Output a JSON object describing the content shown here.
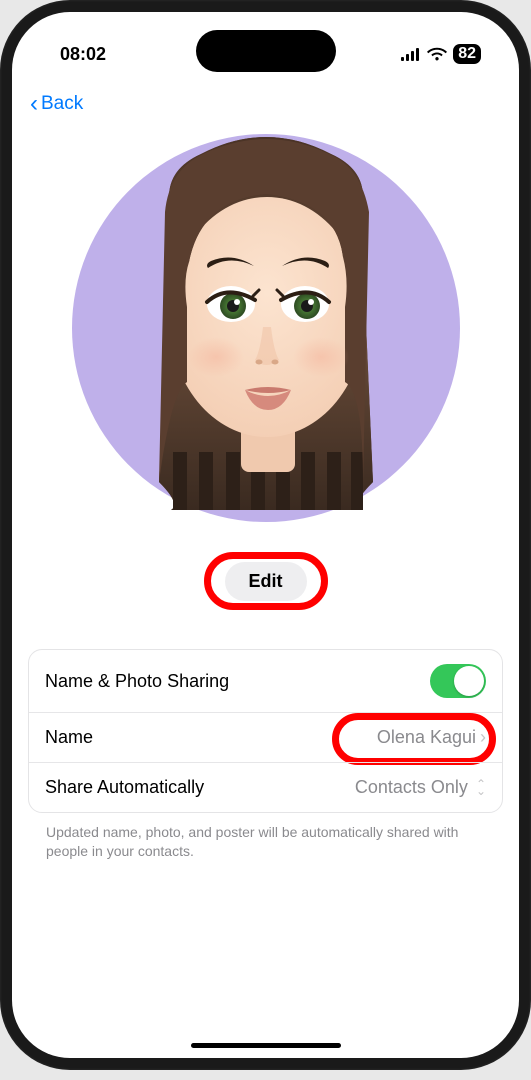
{
  "status_bar": {
    "time": "08:02",
    "battery": "82"
  },
  "nav": {
    "back_label": "Back"
  },
  "profile": {
    "edit_label": "Edit"
  },
  "settings": {
    "sharing_label": "Name & Photo Sharing",
    "name_label": "Name",
    "name_value": "Olena Kagui",
    "auto_label": "Share Automatically",
    "auto_value": "Contacts Only"
  },
  "footer": {
    "text": "Updated name, photo, and poster will be automatically shared with people in your contacts."
  }
}
